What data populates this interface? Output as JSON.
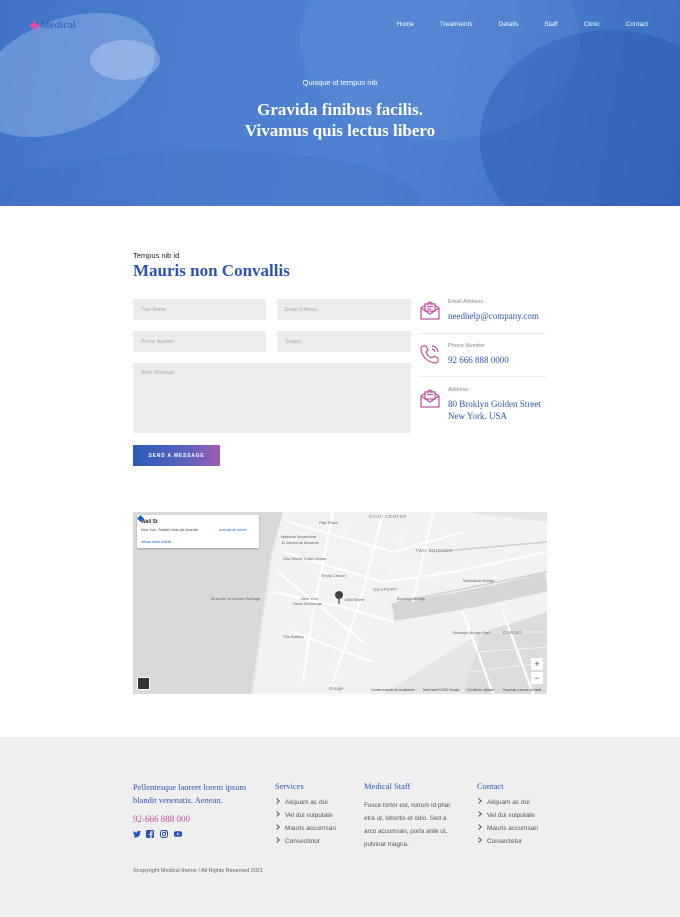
{
  "brand": {
    "name": "Medical"
  },
  "nav": {
    "items": [
      "Home",
      "Treatments",
      "Details",
      "Staff",
      "Clinic",
      "Contact"
    ]
  },
  "hero": {
    "kicker": "Quisque id tempus nib",
    "title_line1": "Gravida finibus facilis.",
    "title_line2": "Vivamus quis lectus libero"
  },
  "contact": {
    "kicker": "Tempus nib id",
    "title": "Mauris non Convallis",
    "form": {
      "name_placeholder": "Your Name",
      "email_placeholder": "Email Address",
      "phone_placeholder": "Phone Number",
      "subject_placeholder": "Subject",
      "message_placeholder": "Write Message",
      "send_label": "SEND A MESSAGE"
    },
    "info": [
      {
        "label": "Email Address",
        "value": "needhelp@company.com",
        "icon": "envelope-icon"
      },
      {
        "label": "Phone Number",
        "value": "92 666 888 0000",
        "icon": "phone-icon"
      },
      {
        "label": "Address",
        "value_line1": "80 Broklyn Golden Street",
        "value_line2": "New York. USA",
        "icon": "mail-open-icon"
      }
    ]
  },
  "map": {
    "card_title": "Wall St",
    "card_address": "New York, Statele Unite ale Americii",
    "card_link": "Afișați harta mărită",
    "card_directions": "Indicații de orient...",
    "labels": {
      "civic_center": "CIVIC CENTER",
      "two_bridges": "TWO BRIDGES",
      "seaport": "SEAPORT",
      "dumbo": "DUMBO",
      "pike_place": "Pike Place",
      "national_sep": "National September",
      "memorial": "11 Memorial Museum",
      "wtc": "One World Trade Center",
      "trinity": "Trinity Church",
      "ny_stock": "New York",
      "stock_exchange": "Stock Exchange",
      "wall_street": "Wall Street",
      "battery": "The Battery",
      "brooklyn_bridge": "Brooklyn Bridge",
      "manhattan_bridge": "Manhattan Bridge",
      "brooklyn_bridge_park": "Brooklyn Bridge Park",
      "museum": "Museum of Jewish Heritage"
    },
    "footer": [
      "Comenzi rapide de la tastatură",
      "Date hartă ©2022 Google",
      "Condiții de utilizare",
      "Raportați o eroare pe hartă"
    ],
    "google": "Google",
    "zoom_in": "+",
    "zoom_out": "−"
  },
  "footer": {
    "about_line1": "Pellentesque laoreet lorem ipsum",
    "about_line2": "blandit venenatis. Aenean.",
    "phone": "92-666 888 000",
    "services": {
      "title": "Services",
      "items": [
        "Aliquam ac dui",
        "Vel dui vulputate",
        "Mauris accumsan",
        "Consectetur"
      ]
    },
    "staff": {
      "title": "Medical Staff",
      "lines": [
        "Fusce tortor est, rutrum id phar",
        "etra ut, lobortis et odio. Sed a",
        "arcu accumsan, porta ante ut,",
        "pulvinar magna."
      ]
    },
    "contact": {
      "title": "Contact",
      "items": [
        "Aliquam ac dui",
        "Vel dui vulputate",
        "Mauris accumsan",
        "Consectetur"
      ]
    },
    "social": [
      "twitter-icon",
      "facebook-icon",
      "instagram-icon",
      "youtube-icon"
    ],
    "copyright": "©copyright Medical theme / All Rights Reserved 2021"
  },
  "colors": {
    "primary": "#2b55b5",
    "accent": "#c0509f",
    "hero": "#4a7ccf",
    "footer_bg": "#efefef"
  }
}
